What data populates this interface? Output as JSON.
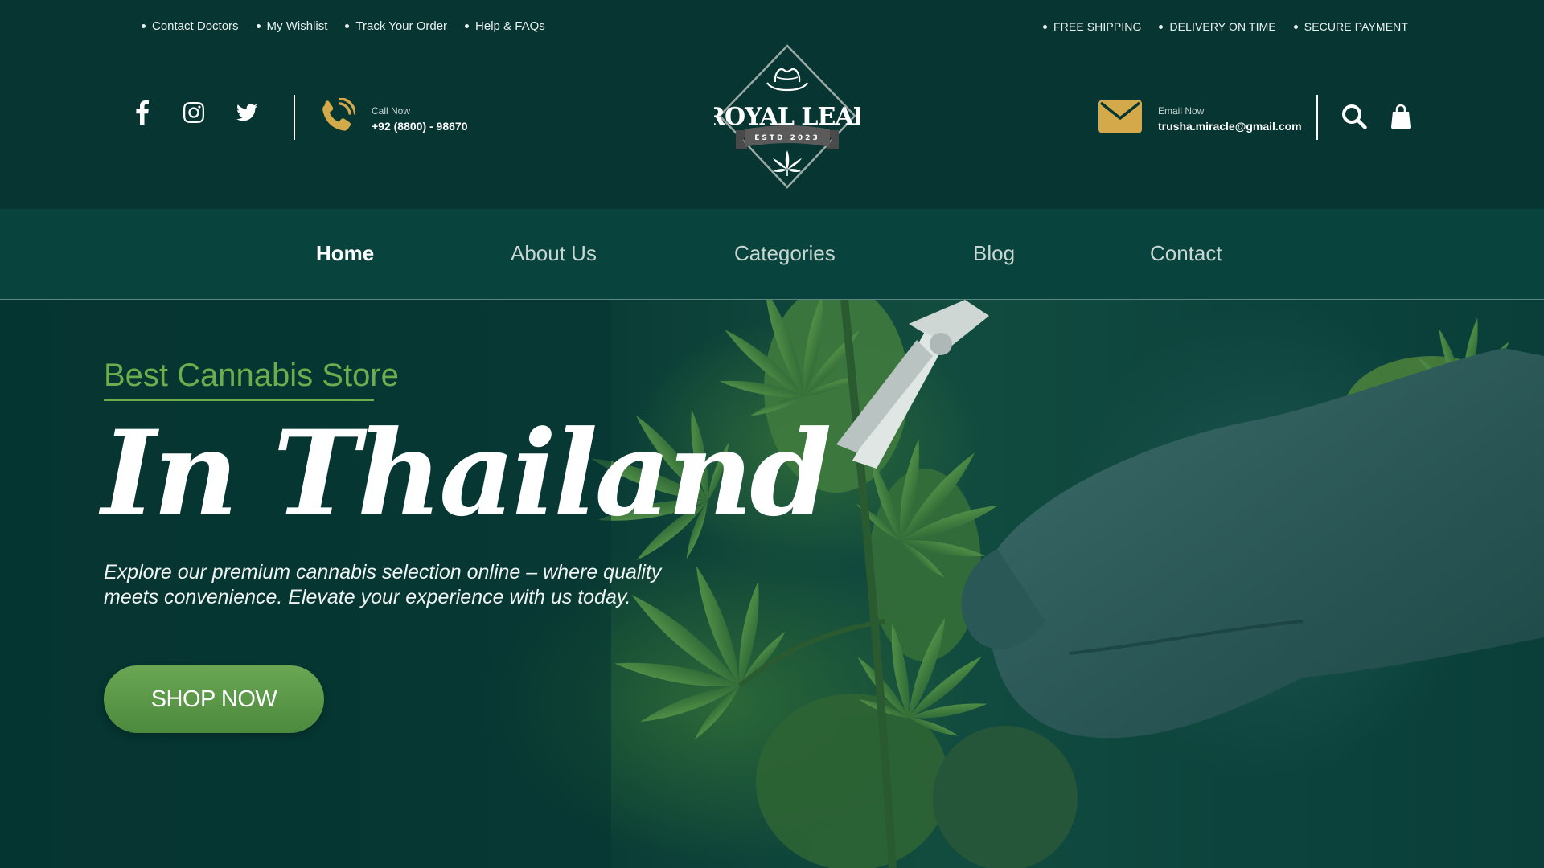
{
  "top_links": [
    "Contact Doctors",
    "My Wishlist",
    "Track Your Order",
    "Help & FAQs"
  ],
  "top_perks": [
    "FREE SHIPPING",
    "DELIVERY ON TIME",
    "SECURE PAYMENT"
  ],
  "social_icons": [
    "facebook-icon",
    "instagram-icon",
    "twitter-icon"
  ],
  "call": {
    "label": "Call Now",
    "value": "+92 (8800) - 98670",
    "icon": "phone-icon"
  },
  "email": {
    "label": "Email Now",
    "value": "trusha.miracle@gmail.com",
    "icon": "envelope-icon"
  },
  "logo": {
    "name": "ROYAL LEAF",
    "tagline": "ESTD 2023"
  },
  "header_icons": [
    "search-icon",
    "shopping-bag-icon"
  ],
  "nav": {
    "items": [
      "Home",
      "About Us",
      "Categories",
      "Blog",
      "Contact"
    ],
    "active": "Home"
  },
  "hero": {
    "kicker": "Best Cannabis Store",
    "title": "In Thailand",
    "description": "Explore our premium cannabis selection online – where quality meets convenience. Elevate your experience with us today.",
    "cta": "SHOP NOW"
  },
  "colors": {
    "background": "#063532",
    "accent_green": "#6cae4d",
    "gold": "#d4a94a",
    "button_green": "#5c9a48"
  }
}
